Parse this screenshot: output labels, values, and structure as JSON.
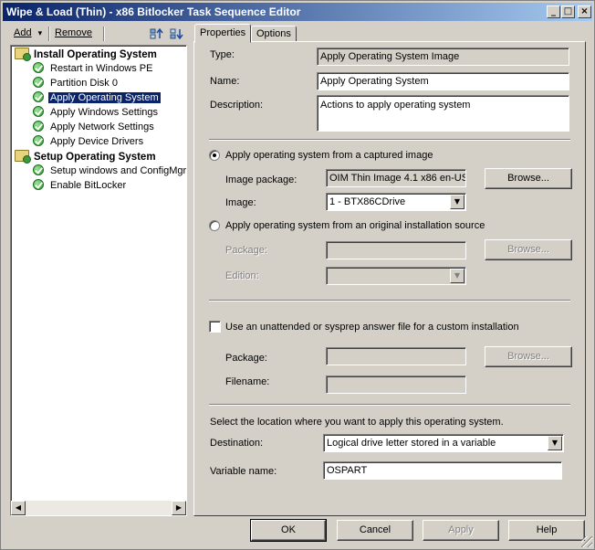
{
  "window": {
    "title": "Wipe & Load (Thin) - x86 Bitlocker Task Sequence Editor",
    "minimize_glyph": "_",
    "maximize_glyph": "□",
    "close_glyph": "×"
  },
  "toolbar": {
    "add_label": "Add",
    "add_arrow": "▾",
    "remove_label": "Remove"
  },
  "tree": {
    "groups": [
      {
        "label": "Install Operating System",
        "items": [
          {
            "label": "Restart in Windows PE"
          },
          {
            "label": "Partition Disk 0"
          },
          {
            "label": "Apply Operating System",
            "selected": true
          },
          {
            "label": "Apply Windows Settings"
          },
          {
            "label": "Apply Network Settings"
          },
          {
            "label": "Apply Device Drivers"
          }
        ]
      },
      {
        "label": "Setup Operating System",
        "items": [
          {
            "label": "Setup windows and ConfigMgr"
          },
          {
            "label": "Enable BitLocker"
          }
        ]
      }
    ],
    "scroll_left": "◀",
    "scroll_right": "▶"
  },
  "tabs": [
    {
      "label": "Properties",
      "active": true
    },
    {
      "label": "Options",
      "active": false
    }
  ],
  "properties": {
    "type_label": "Type:",
    "type_value": "Apply Operating System Image",
    "name_label": "Name:",
    "name_value": "Apply Operating System",
    "description_label": "Description:",
    "description_value": "Actions to apply operating system",
    "radio_captured_label": "Apply operating system from a captured image",
    "image_package_label": "Image package:",
    "image_package_value": "OIM Thin Image 4.1 x86  en-US",
    "browse_label": "Browse...",
    "image_label": "Image:",
    "image_value": "1 - BTX86CDrive",
    "radio_source_label": "Apply operating system from an original installation source",
    "package_label": "Package:",
    "edition_label": "Edition:",
    "unattend_label": "Use an unattended or sysprep answer file for a custom installation",
    "unattend_package_label": "Package:",
    "filename_label": "Filename:",
    "location_text": "Select the location where you want to apply this operating system.",
    "destination_label": "Destination:",
    "destination_value": "Logical drive letter stored in a variable",
    "variable_name_label": "Variable name:",
    "variable_name_value": "OSPART",
    "combo_arrow": "▼"
  },
  "footer": {
    "ok": "OK",
    "cancel": "Cancel",
    "apply": "Apply",
    "help": "Help"
  }
}
